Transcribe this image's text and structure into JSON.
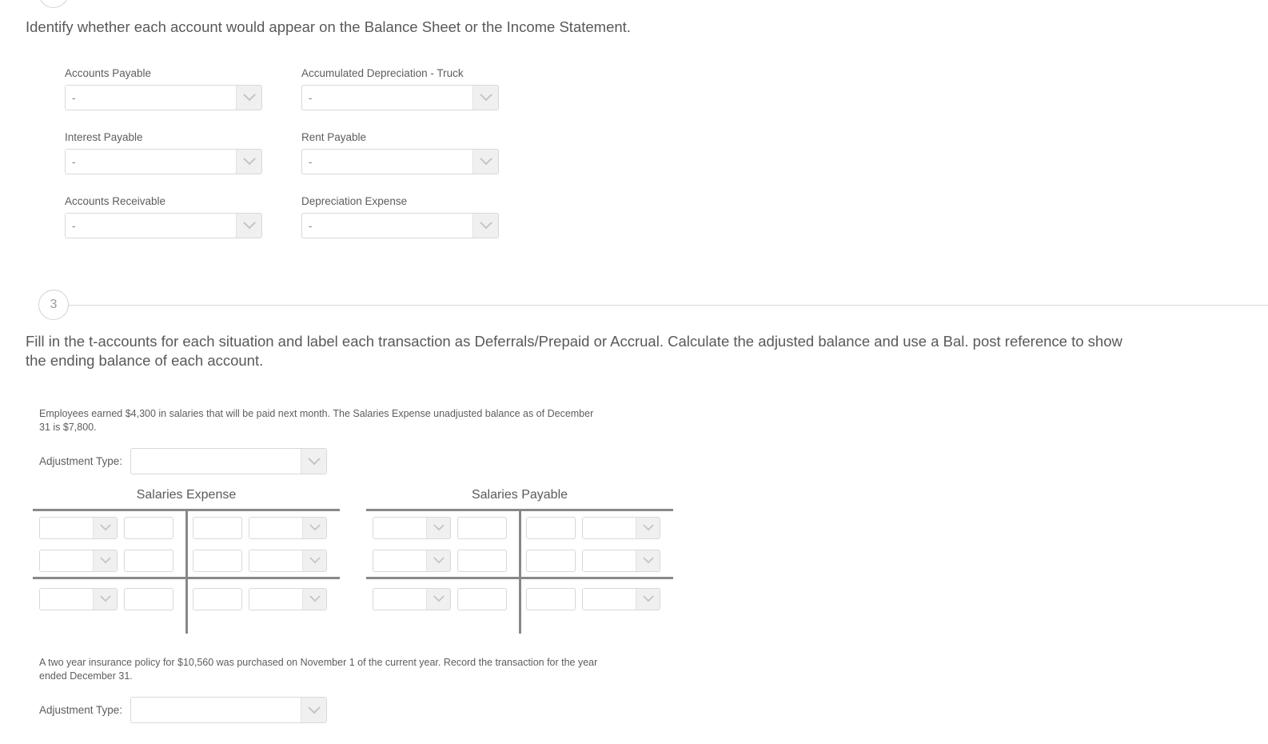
{
  "steps": {
    "top_marker_number": "",
    "step3_number": "3"
  },
  "section2": {
    "prompt": "Identify whether each account would appear on the Balance Sheet or the Income Statement.",
    "accounts": [
      {
        "label": "Accounts Payable",
        "value": "-"
      },
      {
        "label": "Accumulated Depreciation - Truck",
        "value": "-"
      },
      {
        "label": "Interest Payable",
        "value": "-"
      },
      {
        "label": "Rent Payable",
        "value": "-"
      },
      {
        "label": "Accounts Receivable",
        "value": "-"
      },
      {
        "label": "Depreciation Expense",
        "value": "-"
      }
    ]
  },
  "section3": {
    "prompt": "Fill in the t-accounts for each situation and label each transaction as Deferrals/Prepaid or Accrual. Calculate the adjusted balance and use a Bal. post reference to show the ending balance of each account.",
    "situations": [
      {
        "text": "Employees earned $4,300 in salaries that will be paid next month. The Salaries Expense unadjusted balance as of December 31 is $7,800.",
        "adjustment_label": "Adjustment Type:",
        "adjustment_value": ""
      },
      {
        "text": "A two year insurance policy for $10,560 was purchased on November 1 of the current year. Record the transaction for the year ended December 31.",
        "adjustment_label": "Adjustment Type:",
        "adjustment_value": ""
      }
    ],
    "taccounts": [
      {
        "title": "Salaries Expense",
        "rows": [
          {
            "debit_ref": "",
            "debit_amount": "",
            "credit_amount": "",
            "credit_ref": ""
          },
          {
            "debit_ref": "",
            "debit_amount": "",
            "credit_amount": "",
            "credit_ref": ""
          }
        ],
        "balance_row": {
          "debit_ref": "",
          "debit_amount": "",
          "credit_amount": "",
          "credit_ref": ""
        }
      },
      {
        "title": "Salaries Payable",
        "rows": [
          {
            "debit_ref": "",
            "debit_amount": "",
            "credit_amount": "",
            "credit_ref": ""
          },
          {
            "debit_ref": "",
            "debit_amount": "",
            "credit_amount": "",
            "credit_ref": ""
          }
        ],
        "balance_row": {
          "debit_ref": "",
          "debit_amount": "",
          "credit_amount": "",
          "credit_ref": ""
        }
      }
    ]
  },
  "colors": {
    "text": "#5d5d5d",
    "heading": "#595959",
    "rule": "#888888",
    "border": "#d8d8d8",
    "button_face": "#f0f0f0"
  }
}
